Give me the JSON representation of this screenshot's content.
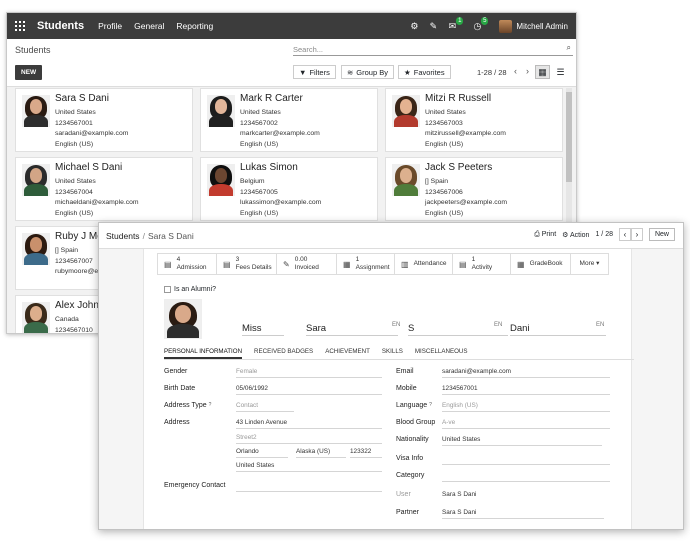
{
  "back_window": {
    "topbar": {
      "app_title": "Students",
      "menu": [
        "Profile",
        "General",
        "Reporting"
      ],
      "chat_badge": "1",
      "activity_badge": "5",
      "user_name": "Mitchell Admin"
    },
    "control_panel": {
      "title": "Students",
      "search_placeholder": "Search...",
      "new_label": "NEW",
      "filters_label": "Filters",
      "groupby_label": "Group By",
      "favorites_label": "Favorites",
      "pager": "1-28 / 28"
    },
    "students": [
      {
        "name": "Sara S Dani",
        "lines": [
          "United States",
          "1234567001",
          "saradani@example.com",
          "English (US)"
        ],
        "hair": "#2a1b12",
        "skin": "#d9a98a",
        "body": "#2d2d2d"
      },
      {
        "name": "Mark R Carter",
        "lines": [
          "United States",
          "1234567002",
          "markcarter@example.com",
          "English (US)"
        ],
        "hair": "#1d1d1d",
        "skin": "#e2b69a",
        "body": "#202020"
      },
      {
        "name": "Mitzi R Russell",
        "lines": [
          "United States",
          "1234567003",
          "mitzirussell@example.com",
          "English (US)"
        ],
        "hair": "#3a2517",
        "skin": "#e4b291",
        "body": "#b23a2d"
      },
      {
        "name": "Michael S Dani",
        "lines": [
          "United States",
          "1234567004",
          "michaeldani@example.com",
          "English (US)"
        ],
        "hair": "#2b2b2b",
        "skin": "#d2a586",
        "body": "#2e5c3a"
      },
      {
        "name": "Lukas Simon",
        "lines": [
          "Belgium",
          "1234567005",
          "lukassimon@example.com",
          "English (US)"
        ],
        "hair": "#0f0f0f",
        "skin": "#6b4631",
        "body": "#c23b2e"
      },
      {
        "name": "Jack S Peeters",
        "lines": [
          "[] Spain",
          "1234567006",
          "jackpeeters@example.com",
          "English (US)"
        ],
        "hair": "#6a4a2a",
        "skin": "#dcb08e",
        "body": "#4f7c3a"
      },
      {
        "name": "Ruby J Moo",
        "lines": [
          "[] Spain",
          "1234567007",
          "rubymoore@ex"
        ],
        "hair": "#2c1a10",
        "skin": "#c9906c",
        "body": "#3d6b8a"
      },
      {
        "name": "Alex Johnso",
        "lines": [
          "Canada",
          "1234567010"
        ],
        "hair": "#3a2a1a",
        "skin": "#dcae8c",
        "body": "#3a6b4a"
      }
    ]
  },
  "front_window": {
    "breadcrumb": {
      "parent": "Students",
      "current": "Sara S Dani"
    },
    "print_label": "Print",
    "action_label": "Action",
    "pager": "1 / 28",
    "new_label": "New",
    "stat_buttons": [
      {
        "value": "4",
        "label": "Admission",
        "icon": "file-icon"
      },
      {
        "value": "3",
        "label": "Fees Details",
        "icon": "file-icon"
      },
      {
        "value": "0.00",
        "label": "Invoiced",
        "icon": "edit-icon"
      },
      {
        "value": "1",
        "label": "Assignment",
        "icon": "grid-icon"
      },
      {
        "value": "",
        "label": "Attendance",
        "icon": "calendar-icon"
      },
      {
        "value": "1",
        "label": "Activity",
        "icon": "file-icon"
      },
      {
        "value": "",
        "label": "GradeBook",
        "icon": "grid-icon"
      },
      {
        "value": "",
        "label": "More ▾",
        "icon": ""
      }
    ],
    "alumni_label": "Is an Alumni?",
    "name": {
      "title": "Miss",
      "first": "Sara",
      "middle": "S",
      "last": "Dani",
      "lang_tag": "EN"
    },
    "tabs": [
      "PERSONAL INFORMATION",
      "RECEIVED BADGES",
      "ACHIEVEMENT",
      "SKILLS",
      "MISCELLANEOUS"
    ],
    "left_fields": {
      "gender_label": "Gender",
      "gender_value": "Female",
      "birth_label": "Birth Date",
      "birth_value": "05/06/1992",
      "address_type_label": "Address Type",
      "address_type_value": "Contact",
      "help_mark": "?",
      "address_label": "Address",
      "street": "43 Linden Avenue",
      "street2": "Street2",
      "city": "Orlando",
      "state": "Alaska (US)",
      "zip": "123322",
      "country": "United States",
      "emergency_label": "Emergency Contact"
    },
    "right_fields": {
      "email_label": "Email",
      "email_value": "saradani@example.com",
      "mobile_label": "Mobile",
      "mobile_value": "1234567001",
      "language_label": "Language",
      "language_value": "English (US)",
      "blood_label": "Blood Group",
      "blood_value": "A-ve",
      "nationality_label": "Nationality",
      "nationality_value": "United States",
      "visa_label": "Visa Info",
      "category_label": "Category",
      "user_label": "User",
      "user_value": "Sara S Dani",
      "partner_label": "Partner",
      "partner_value": "Sara S Dani"
    }
  }
}
